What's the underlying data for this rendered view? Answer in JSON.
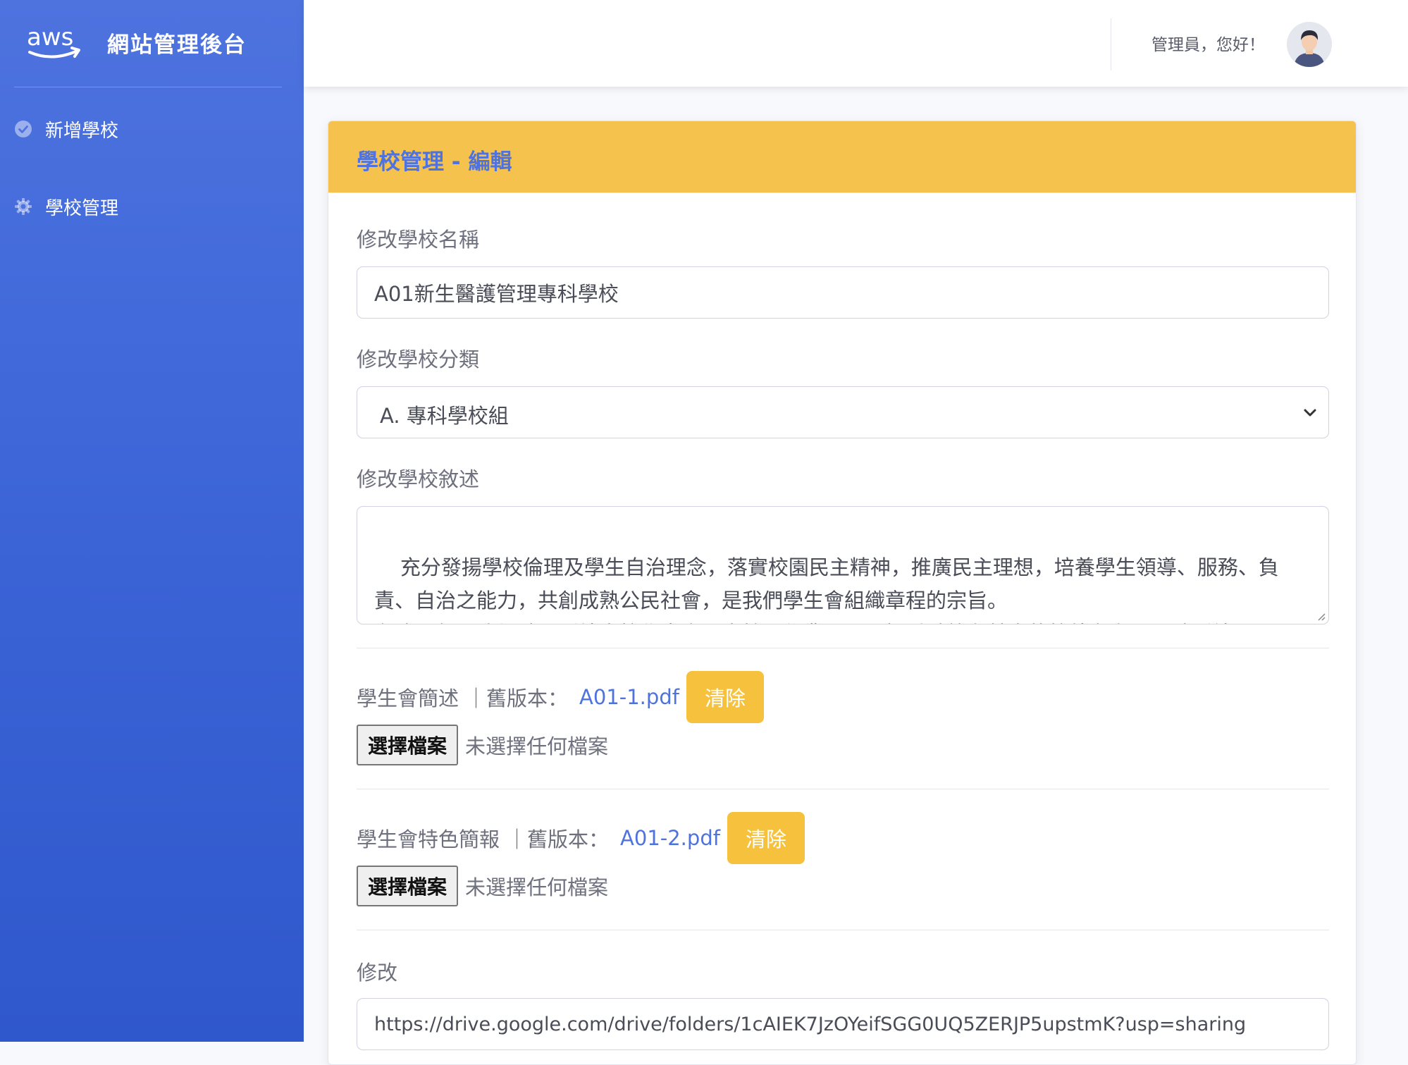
{
  "sidebar": {
    "brand_logo_text": "aws",
    "brand_title": "網站管理後台",
    "items": [
      {
        "label": "新增學校",
        "icon": "check-circle-icon"
      },
      {
        "label": "學校管理",
        "icon": "gear-icon"
      }
    ]
  },
  "topbar": {
    "greeting": "管理員，您好！",
    "avatar_icon": "user-avatar-icon"
  },
  "card": {
    "title": "學校管理 - 編輯",
    "school_name": {
      "label": "修改學校名稱",
      "value": "A01新生醫護管理專科學校"
    },
    "school_category": {
      "label": "修改學校分類",
      "selected": "A. 專科學校組"
    },
    "school_description": {
      "label": "修改學校敘述",
      "value": "充分發揚學校倫理及學生自治理念，落實校園民主精神，推廣民主理想，培養學生領導、服務、負責、自治之能力，共創成熟公民社會，是我們學生會組織章程的宗旨。\n在這一年，我們除了延續本校學生會三大核心作業，更是把重點放在其中的校外參與，同時延續"
    },
    "files": [
      {
        "label": "學生會簡述",
        "separator": "｜舊版本：",
        "file_name": "A01-1.pdf",
        "clear_label": "清除",
        "choose_label": "選擇檔案",
        "status": "未選擇任何檔案"
      },
      {
        "label": "學生會特色簡報",
        "separator": "｜舊版本：",
        "file_name": "A01-2.pdf",
        "clear_label": "清除",
        "choose_label": "選擇檔案",
        "status": "未選擇任何檔案"
      }
    ],
    "link_field": {
      "label": "修改",
      "value": "https://drive.google.com/drive/folders/1cAIEK7JzOYeifSGG0UQ5ZERJP5upstmK?usp=sharing"
    }
  },
  "colors": {
    "sidebar": "#4e73df",
    "header": "#f6c24e",
    "clear_button": "#f6c23e",
    "link": "#4e73df"
  }
}
